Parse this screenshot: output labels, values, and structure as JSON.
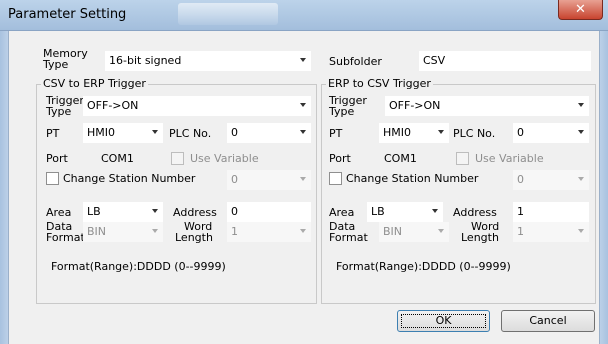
{
  "window": {
    "title": "Parameter Setting",
    "close_glyph": "✕"
  },
  "top": {
    "memory_type_label_1": "Memory",
    "memory_type_label_2": "Type",
    "memory_type_value": "16-bit signed",
    "subfolder_label": "Subfolder",
    "subfolder_value": "CSV"
  },
  "csv_to_erp": {
    "title": "CSV to ERP Trigger",
    "trigger_type_label_1": "Trigger",
    "trigger_type_label_2": "Type",
    "trigger_type_value": "OFF->ON",
    "pt_label": "PT",
    "pt_value": "HMI0",
    "plc_no_label": "PLC No.",
    "plc_no_value": "0",
    "port_label": "Port",
    "port_value": "COM1",
    "use_variable_label": "Use Variable",
    "change_station_label": "Change Station Number",
    "change_station_value": "0",
    "area_label": "Area",
    "area_value": "LB",
    "address_label": "Address",
    "address_value": "0",
    "data_format_label_1": "Data",
    "data_format_label_2": "Format",
    "data_format_value": "BIN",
    "word_length_label_1": "Word",
    "word_length_label_2": "Length",
    "word_length_value": "1",
    "format_range": "Format(Range):DDDD (0--9999)"
  },
  "erp_to_csv": {
    "title": "ERP to CSV Trigger",
    "trigger_type_label_1": "Trigger",
    "trigger_type_label_2": "Type",
    "trigger_type_value": "OFF->ON",
    "pt_label": "PT",
    "pt_value": "HMI0",
    "plc_no_label": "PLC No.",
    "plc_no_value": "0",
    "port_label": "Port",
    "port_value": "COM1",
    "use_variable_label": "Use Variable",
    "change_station_label": "Change Station Number",
    "change_station_value": "0",
    "area_label": "Area",
    "area_value": "LB",
    "address_label": "Address",
    "address_value": "1",
    "data_format_label_1": "Data",
    "data_format_label_2": "Format",
    "data_format_value": "BIN",
    "word_length_label_1": "Word",
    "word_length_label_2": "Length",
    "word_length_value": "1",
    "format_range": "Format(Range):DDDD (0--9999)"
  },
  "buttons": {
    "ok": "OK",
    "cancel": "Cancel"
  }
}
